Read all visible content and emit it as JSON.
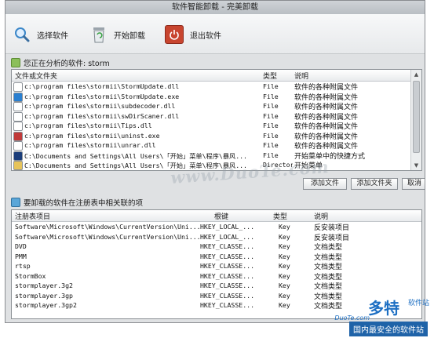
{
  "window": {
    "title": "软件智能卸载 - 完美卸载"
  },
  "toolbar": {
    "select_label": "选择软件",
    "uninstall_label": "开始卸载",
    "exit_label": "退出软件"
  },
  "files_section": {
    "label": "您正在分析的软件: storm",
    "columns": [
      "文件或文件夹",
      "类型",
      "说明"
    ],
    "rows": [
      {
        "path": "c:\\program files\\stormii\\StormUpdate.dll",
        "type": "File",
        "desc": "软件的各种附属文件",
        "icon": "dll-file-icon",
        "color": "#ffffff"
      },
      {
        "path": "c:\\program files\\stormii\\StormUpdate.exe",
        "type": "File",
        "desc": "软件的各种附属文件",
        "icon": "exe-globe-icon",
        "color": "#2a7fd0"
      },
      {
        "path": "c:\\program files\\stormii\\subdecoder.dll",
        "type": "File",
        "desc": "软件的各种附属文件",
        "icon": "dll-file-icon",
        "color": "#ffffff"
      },
      {
        "path": "c:\\program files\\stormii\\swDirScaner.dll",
        "type": "File",
        "desc": "软件的各种附属文件",
        "icon": "dll-file-icon",
        "color": "#ffffff"
      },
      {
        "path": "c:\\program files\\stormii\\Tips.dll",
        "type": "File",
        "desc": "软件的各种附属文件",
        "icon": "dll-file-icon",
        "color": "#ffffff"
      },
      {
        "path": "c:\\program files\\stormii\\uninst.exe",
        "type": "File",
        "desc": "软件的各种附属文件",
        "icon": "uninstall-exe-icon",
        "color": "#c03a3a"
      },
      {
        "path": "c:\\program files\\stormii\\unrar.dll",
        "type": "File",
        "desc": "软件的各种附属文件",
        "icon": "dll-file-icon",
        "color": "#ffffff"
      },
      {
        "path": "C:\\Documents and Settings\\All Users\\「开始」菜单\\程序\\暴风...",
        "type": "File",
        "desc": "开始菜单中的快捷方式",
        "icon": "storm-shortcut-icon",
        "color": "#1b3d7a"
      },
      {
        "path": "C:\\Documents and Settings\\All Users\\「开始」菜单\\程序\\暴风...",
        "type": "Directory",
        "desc": "开始菜单",
        "icon": "folder-icon",
        "color": "#e6c35a"
      }
    ],
    "buttons": [
      "添加文件",
      "添加文件夹",
      "取消"
    ]
  },
  "registry_section": {
    "label": "要卸载的软件在注册表中相关联的项",
    "columns": [
      "注册表项目",
      "根键",
      "类型",
      "说明"
    ],
    "rows": [
      {
        "item": "Software\\Microsoft\\Windows\\CurrentVersion\\Uni...",
        "root": "HKEY_LOCAL_...",
        "type": "Key",
        "desc": "反安装项目"
      },
      {
        "item": "Software\\Microsoft\\Windows\\CurrentVersion\\Uni...",
        "root": "HKEY_LOCAL_...",
        "type": "Key",
        "desc": "反安装项目"
      },
      {
        "item": "DVD",
        "root": "HKEY_CLASSE...",
        "type": "Key",
        "desc": "文档类型"
      },
      {
        "item": "PMM",
        "root": "HKEY_CLASSE...",
        "type": "Key",
        "desc": "文档类型"
      },
      {
        "item": "rtsp",
        "root": "HKEY_CLASSE...",
        "type": "Key",
        "desc": "文档类型"
      },
      {
        "item": "StormBox",
        "root": "HKEY_CLASSE...",
        "type": "Key",
        "desc": "文档类型"
      },
      {
        "item": "stormplayer.3g2",
        "root": "HKEY_CLASSE...",
        "type": "Key",
        "desc": "文档类型"
      },
      {
        "item": "stormplayer.3gp",
        "root": "HKEY_CLASSE...",
        "type": "Key",
        "desc": "文档类型"
      },
      {
        "item": "stormplayer.3gp2",
        "root": "HKEY_CLASSE...",
        "type": "Key",
        "desc": "文档类型"
      }
    ]
  },
  "watermark": "www.DuoTe.com",
  "brand": {
    "logo": "多特",
    "sub": "软件站",
    "english": "DuoTe.com",
    "tagline": "国内最安全的软件站"
  }
}
